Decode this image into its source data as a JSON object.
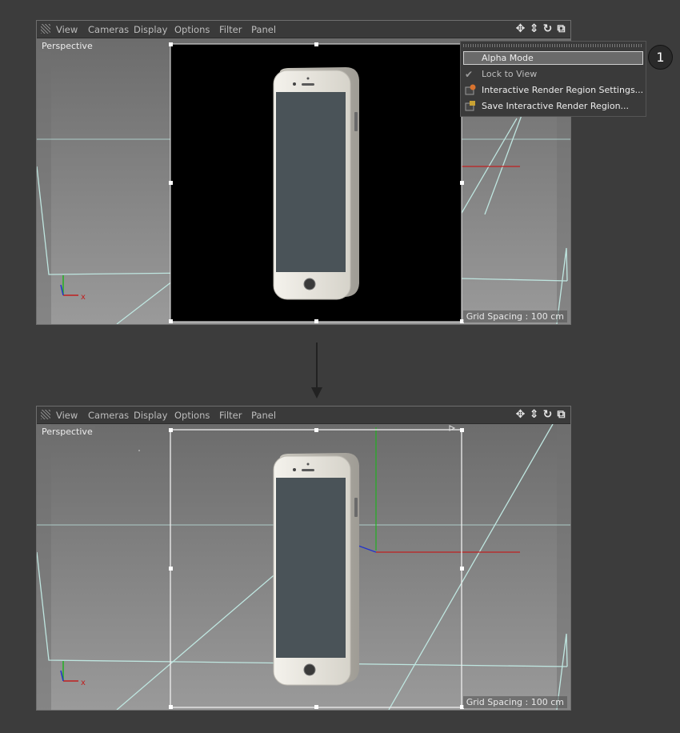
{
  "menu": [
    "View",
    "Cameras",
    "Display",
    "Options",
    "Filter",
    "Panel"
  ],
  "icons": [
    "move-icon",
    "move-vertical-icon",
    "rotate-icon",
    "maximize-icon"
  ],
  "viewport": {
    "label": "Perspective",
    "grid_spacing": "Grid Spacing : 100 cm",
    "axis_x": "x"
  },
  "popup": {
    "items": [
      {
        "label": "Alpha Mode",
        "highlighted": true
      },
      {
        "label": "Lock to View",
        "checked": true
      },
      {
        "label": "Interactive Render Region Settings...",
        "icon": "render-settings-icon"
      },
      {
        "label": "Save Interactive Render Region...",
        "icon": "save-render-region-icon"
      }
    ]
  },
  "callout": "1",
  "colors": {
    "app_bg": "#3c3c3c",
    "menubar_bg": "#3a3a3a",
    "grid_line": "#bfe6e0",
    "axis_x": "#c02020",
    "axis_y": "#22b022",
    "axis_z": "#2233cc",
    "render_bg": "#000000",
    "screen": "#4a5358",
    "phone_body": "#e7e5dd"
  }
}
